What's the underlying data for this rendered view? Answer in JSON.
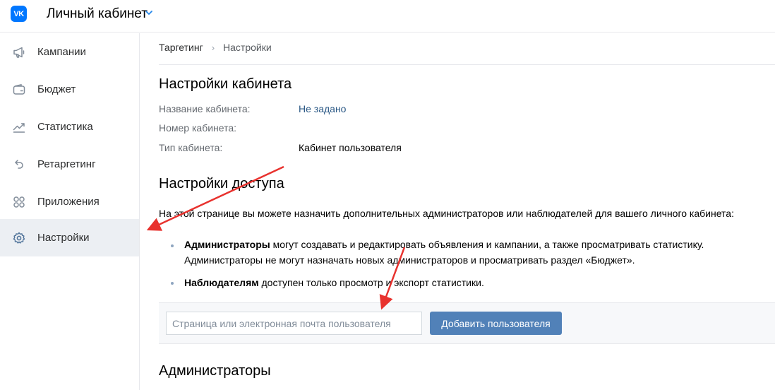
{
  "header": {
    "logo": "VK",
    "title": "Личный кабинет"
  },
  "sidebar": {
    "items": [
      {
        "label": "Кампании",
        "icon": "megaphone-icon"
      },
      {
        "label": "Бюджет",
        "icon": "wallet-icon"
      },
      {
        "label": "Статистика",
        "icon": "chart-line-icon"
      },
      {
        "label": "Ретаргетинг",
        "icon": "undo-arrow-icon"
      },
      {
        "label": "Приложения",
        "icon": "apps-grid-icon"
      },
      {
        "label": "Настройки",
        "icon": "gear-icon",
        "active": true
      }
    ]
  },
  "breadcrumb": {
    "parent": "Таргетинг",
    "separator": "›",
    "current": "Настройки"
  },
  "cabinet_settings": {
    "title": "Настройки кабинета",
    "name_label": "Название кабинета:",
    "name_value": "Не задано",
    "number_label": "Номер кабинета:",
    "type_label": "Тип кабинета:",
    "type_value": "Кабинет пользователя"
  },
  "access_settings": {
    "title": "Настройки доступа",
    "intro": "На этой странице вы можете назначить дополнительных администраторов или наблюдателей для вашего личного кабинета:",
    "admins_bold": "Администраторы",
    "admins_text_1": " могут создавать и редактировать объявления и кампании, а также просматривать статистику.",
    "admins_text_2": "Администраторы не могут назначать новых администраторов и просматривать раздел «Бюджет».",
    "observers_bold": "Наблюдателям",
    "observers_text": " доступен только просмотр и экспорт статистики.",
    "input_placeholder": "Страница или электронная почта пользователя",
    "add_button": "Добавить пользователя"
  },
  "admins_section": {
    "title": "Администраторы"
  },
  "colors": {
    "accent": "#5181b8",
    "link": "#2a5885",
    "annotation_arrow": "#e8322e",
    "active_nav_bg": "#eceff3"
  }
}
